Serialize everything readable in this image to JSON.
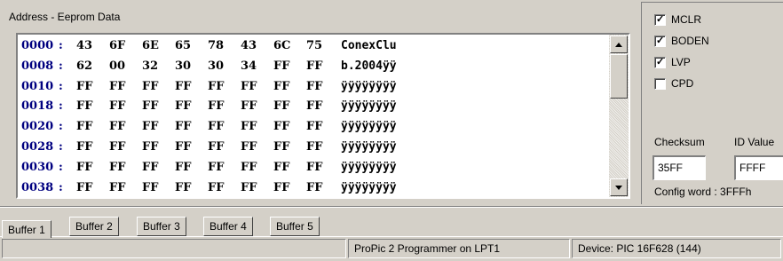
{
  "eeprom": {
    "title": "Address - Eeprom Data",
    "rows": [
      {
        "addr": "0000",
        "bytes": [
          "43",
          "6F",
          "6E",
          "65",
          "78",
          "43",
          "6C",
          "75"
        ],
        "ascii": "ConexClu"
      },
      {
        "addr": "0008",
        "bytes": [
          "62",
          "00",
          "32",
          "30",
          "30",
          "34",
          "FF",
          "FF"
        ],
        "ascii": "b.2004ÿÿ"
      },
      {
        "addr": "0010",
        "bytes": [
          "FF",
          "FF",
          "FF",
          "FF",
          "FF",
          "FF",
          "FF",
          "FF"
        ],
        "ascii": "ÿÿÿÿÿÿÿÿ"
      },
      {
        "addr": "0018",
        "bytes": [
          "FF",
          "FF",
          "FF",
          "FF",
          "FF",
          "FF",
          "FF",
          "FF"
        ],
        "ascii": "ÿÿÿÿÿÿÿÿ"
      },
      {
        "addr": "0020",
        "bytes": [
          "FF",
          "FF",
          "FF",
          "FF",
          "FF",
          "FF",
          "FF",
          "FF"
        ],
        "ascii": "ÿÿÿÿÿÿÿÿ"
      },
      {
        "addr": "0028",
        "bytes": [
          "FF",
          "FF",
          "FF",
          "FF",
          "FF",
          "FF",
          "FF",
          "FF"
        ],
        "ascii": "ÿÿÿÿÿÿÿÿ"
      },
      {
        "addr": "0030",
        "bytes": [
          "FF",
          "FF",
          "FF",
          "FF",
          "FF",
          "FF",
          "FF",
          "FF"
        ],
        "ascii": "ÿÿÿÿÿÿÿÿ"
      },
      {
        "addr": "0038",
        "bytes": [
          "FF",
          "FF",
          "FF",
          "FF",
          "FF",
          "FF",
          "FF",
          "FF"
        ],
        "ascii": "ÿÿÿÿÿÿÿÿ"
      }
    ]
  },
  "config": {
    "checkboxes": [
      {
        "label": "MCLR",
        "checked": true
      },
      {
        "label": "BODEN",
        "checked": true
      },
      {
        "label": "LVP",
        "checked": true
      },
      {
        "label": "CPD",
        "checked": false
      }
    ],
    "checksum_label": "Checksum",
    "checksum_value": "35FF",
    "idvalue_label": "ID Value",
    "idvalue_value": "FFFF",
    "config_word": "Config word : 3FFFh"
  },
  "tabs": [
    {
      "label": "Buffer 1",
      "active": true
    },
    {
      "label": "Buffer 2",
      "active": false
    },
    {
      "label": "Buffer 3",
      "active": false
    },
    {
      "label": "Buffer 4",
      "active": false
    },
    {
      "label": "Buffer 5",
      "active": false
    }
  ],
  "status": {
    "programmer": "ProPic 2 Programmer on LPT1",
    "device": "Device: PIC 16F628  (144)"
  },
  "colors": {
    "face": "#d4d0c8",
    "address": "#000080",
    "text": "#000000"
  }
}
